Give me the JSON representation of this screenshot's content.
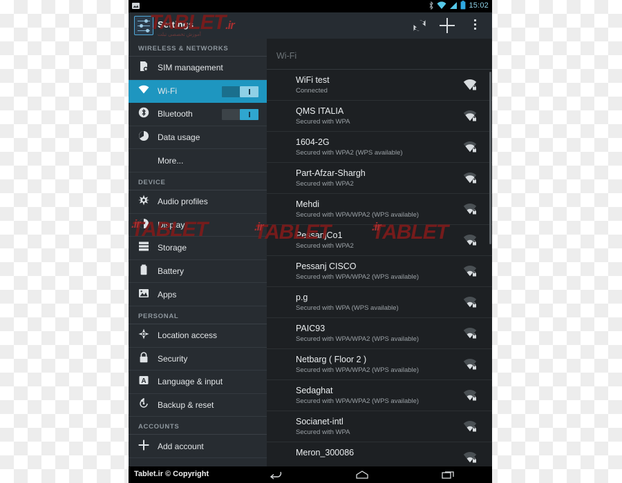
{
  "statusbar": {
    "time": "15:02",
    "icons": [
      "screenshot-icon",
      "bluetooth-icon",
      "wifi-icon",
      "signal-icon",
      "battery-icon"
    ]
  },
  "actionbar": {
    "title": "Settings",
    "scan_label": "scan",
    "add_label": "add",
    "overflow_label": "more options"
  },
  "watermark": {
    "brand": "TABLET",
    "tld": ".ir",
    "tagline": "آموزش تخصصی تبلت"
  },
  "sidebar": {
    "sections": [
      {
        "header": "WIRELESS & NETWORKS",
        "items": [
          {
            "label": "SIM management",
            "icon": "sim-card-icon",
            "selected": false,
            "toggle": null
          },
          {
            "label": "Wi-Fi",
            "icon": "wifi-icon",
            "selected": true,
            "toggle": "on"
          },
          {
            "label": "Bluetooth",
            "icon": "bluetooth-icon",
            "selected": false,
            "toggle": "on"
          },
          {
            "label": "Data usage",
            "icon": "data-usage-icon",
            "selected": false,
            "toggle": null
          },
          {
            "label": "More...",
            "icon": null,
            "selected": false,
            "toggle": null
          }
        ]
      },
      {
        "header": "DEVICE",
        "items": [
          {
            "label": "Audio profiles",
            "icon": "audio-profiles-icon",
            "selected": false,
            "toggle": null
          },
          {
            "label": "Display",
            "icon": "display-icon",
            "selected": false,
            "toggle": null
          },
          {
            "label": "Storage",
            "icon": "storage-icon",
            "selected": false,
            "toggle": null
          },
          {
            "label": "Battery",
            "icon": "battery-icon",
            "selected": false,
            "toggle": null
          },
          {
            "label": "Apps",
            "icon": "apps-icon",
            "selected": false,
            "toggle": null
          }
        ]
      },
      {
        "header": "PERSONAL",
        "items": [
          {
            "label": "Location access",
            "icon": "location-icon",
            "selected": false,
            "toggle": null
          },
          {
            "label": "Security",
            "icon": "lock-icon",
            "selected": false,
            "toggle": null
          },
          {
            "label": "Language & input",
            "icon": "language-icon",
            "selected": false,
            "toggle": null
          },
          {
            "label": "Backup & reset",
            "icon": "backup-reset-icon",
            "selected": false,
            "toggle": null
          }
        ]
      },
      {
        "header": "ACCOUNTS",
        "items": [
          {
            "label": "Add account",
            "icon": "plus-icon",
            "selected": false,
            "toggle": null
          }
        ]
      }
    ]
  },
  "wifi_panel": {
    "title": "Wi-Fi",
    "networks": [
      {
        "name": "WiFi test",
        "status": "Connected",
        "signal": 4,
        "secured": true
      },
      {
        "name": "QMS ITALIA",
        "status": "Secured with WPA",
        "signal": 3,
        "secured": true
      },
      {
        "name": "1604-2G",
        "status": "Secured with WPA2 (WPS available)",
        "signal": 3,
        "secured": true
      },
      {
        "name": "Part-Afzar-Shargh",
        "status": "Secured with WPA2",
        "signal": 3,
        "secured": true
      },
      {
        "name": "Mehdi",
        "status": "Secured with WPA/WPA2 (WPS available)",
        "signal": 2,
        "secured": true
      },
      {
        "name": "PessanjCo1",
        "status": "Secured with WPA2",
        "signal": 2,
        "secured": true
      },
      {
        "name": "Pessanj CISCO",
        "status": "Secured with WPA/WPA2 (WPS available)",
        "signal": 2,
        "secured": true
      },
      {
        "name": "p.g",
        "status": "Secured with WPA (WPS available)",
        "signal": 2,
        "secured": true
      },
      {
        "name": "PAIC93",
        "status": "Secured with WPA/WPA2 (WPS available)",
        "signal": 2,
        "secured": true
      },
      {
        "name": "Netbarg ( Floor 2 )",
        "status": "Secured with WPA/WPA2 (WPS available)",
        "signal": 2,
        "secured": true
      },
      {
        "name": "Sedaghat",
        "status": "Secured with WPA/WPA2 (WPS available)",
        "signal": 2,
        "secured": true
      },
      {
        "name": "Socianet-intl",
        "status": "Secured with WPA",
        "signal": 2,
        "secured": true
      },
      {
        "name": "Meron_300086",
        "status": "",
        "signal": 2,
        "secured": true
      }
    ]
  },
  "navbar": {
    "copyright": "Tablet.ir © Copyright",
    "buttons": [
      {
        "label": "Back",
        "icon": "back-icon"
      },
      {
        "label": "Home",
        "icon": "home-icon"
      },
      {
        "label": "Recents",
        "icon": "recents-icon"
      }
    ]
  },
  "colors": {
    "accent": "#1e96c0",
    "statusbar_time": "#8fd3e8",
    "sidebar_bg": "#272c31",
    "panel_bg": "#1d2023",
    "watermark": "#7d1b1b"
  }
}
